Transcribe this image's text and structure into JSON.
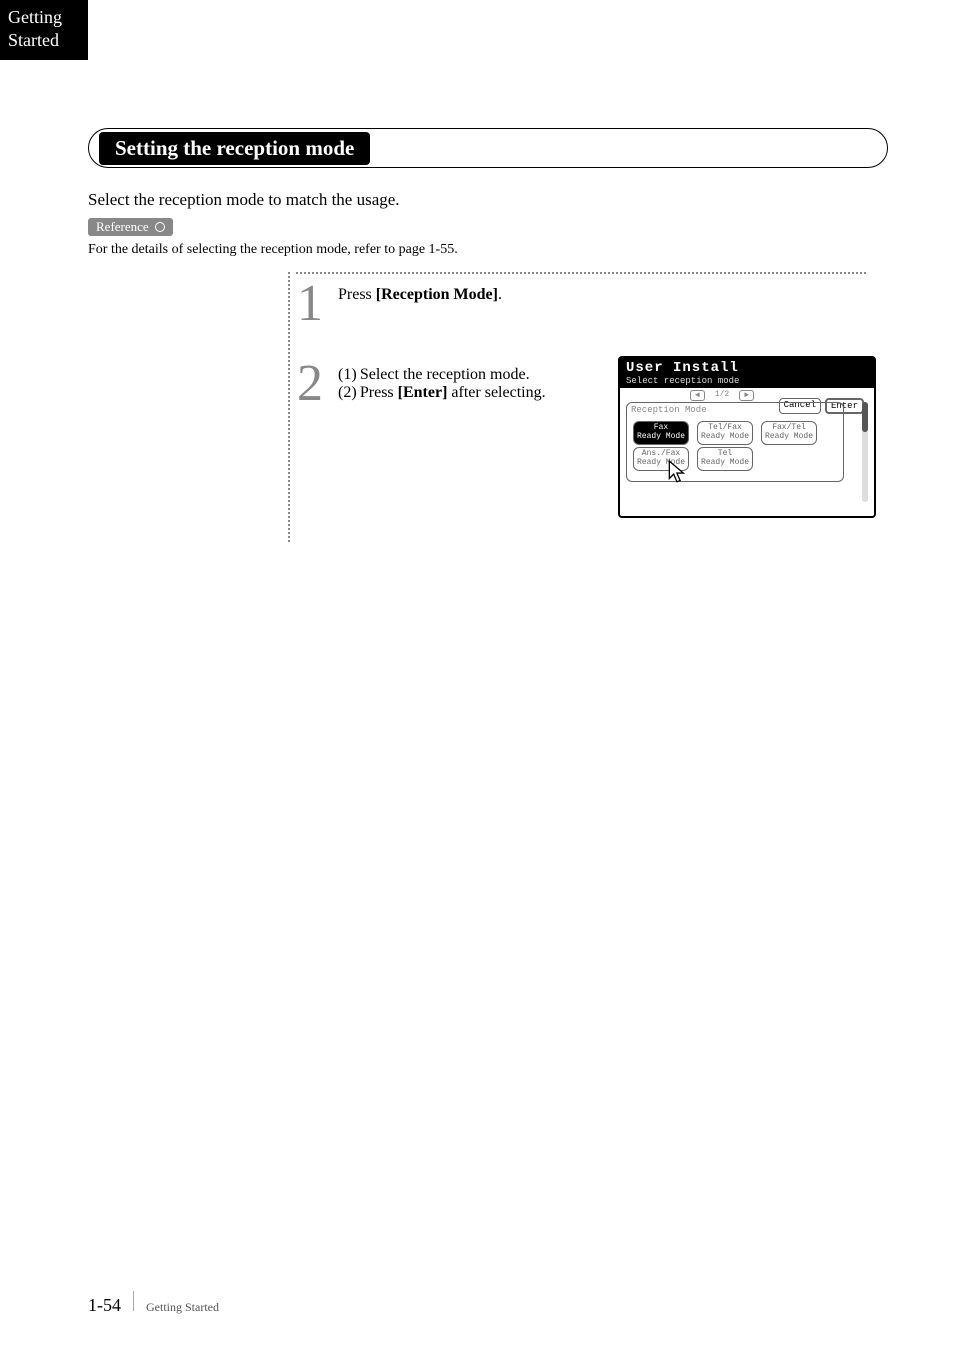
{
  "sidebar": {
    "chapter": "Getting\nStarted"
  },
  "section_title": "Setting the reception mode",
  "lead": "Select the reception mode to match the usage.",
  "reference_label": "Reference",
  "reference_text": "For the details of selecting the reception mode, refer to page 1-55.",
  "steps": [
    {
      "num": "1",
      "lines": [
        "Press ",
        "[Reception Mode]",
        "."
      ]
    },
    {
      "num": "2",
      "lines": [
        "(1) Select the reception mode.",
        "(2) Press ",
        "[Enter]",
        " after selecting."
      ]
    }
  ],
  "screen": {
    "title": "User Install",
    "subtitle": "Select reception mode",
    "panel_label": "Reception Mode",
    "pager": "1/2",
    "buttons": {
      "cancel": "Cancel",
      "enter": "Enter"
    },
    "options": [
      {
        "line1": "Fax",
        "line2": "Ready Mode",
        "selected": true
      },
      {
        "line1": "Tel/Fax",
        "line2": "Ready Mode",
        "selected": false
      },
      {
        "line1": "Fax/Tel",
        "line2": "Ready Mode",
        "selected": false
      },
      {
        "line1": "Ans./Fax",
        "line2": "Ready Mode",
        "selected": false
      },
      {
        "line1": "Tel",
        "line2": "Ready Mode",
        "selected": false
      }
    ]
  },
  "footer": {
    "page": "1-54",
    "chapter": "Getting Started"
  }
}
